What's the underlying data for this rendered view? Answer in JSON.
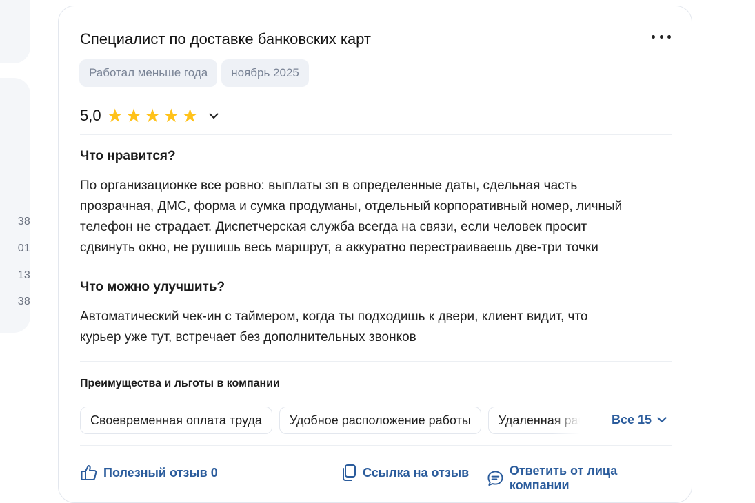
{
  "left_panel": {
    "numbers": [
      "38",
      "01",
      "13",
      "38"
    ]
  },
  "review": {
    "title": "Специалист по доставке банковских карт",
    "tags": [
      "Работал меньше года",
      "ноябрь 2025"
    ],
    "rating": "5,0",
    "stars": 5,
    "likes_title": "Что нравится?",
    "likes_text_lines": [
      "По организационке все ровно: выплаты зп в определенные даты, сдельная часть",
      "прозрачная, ДМС, форма и сумка продуманы, отдельный корпоративный номер, личный",
      "телефон не страдает. Диспетчерская служба всегда на связи, если человек просит",
      "сдвинуть окно, не рушишь весь маршрут, а аккуратно перестраиваешь две-три точки"
    ],
    "improve_title": "Что можно улучшить?",
    "improve_text_lines": [
      "Автоматический чек-ин с таймером, когда ты подходишь к двери, клиент видит, что",
      "курьер уже тут, встречает без дополнительных звонков"
    ],
    "benefits_title": "Преимущества и льготы в компании",
    "benefits": [
      "Своевременная оплата труда",
      "Удобное расположение работы",
      "Удаленная работа"
    ],
    "benefits_all": "Все 15",
    "actions": {
      "helpful": "Полезный отзыв 0",
      "link": "Ссылка на отзыв",
      "reply": "Ответить от лица компании"
    }
  },
  "colors": {
    "accent": "#2b5c9c",
    "star": "#ffc21a",
    "tag_bg": "#eef1f6",
    "border": "#e3e7ee"
  }
}
